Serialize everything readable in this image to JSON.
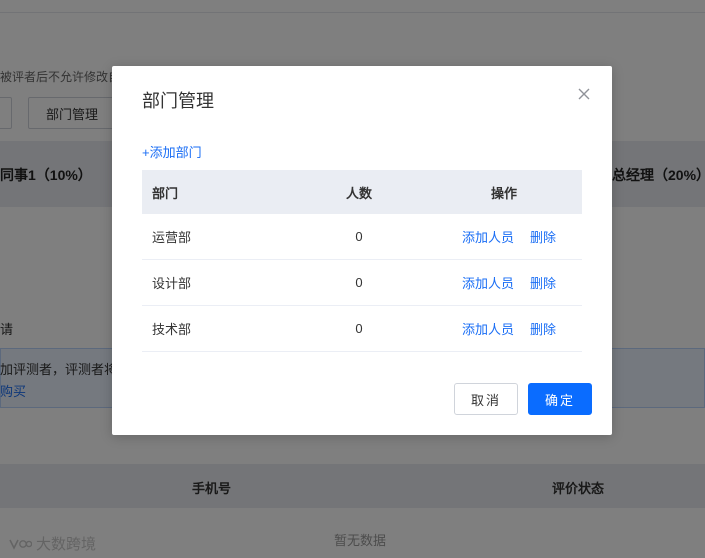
{
  "background": {
    "note": "被评者后不允许修改自",
    "btn_left": "",
    "btn_dept": "部门管理",
    "band_left": "同事1（10%）",
    "band_right": "总经理（20%）",
    "invite": "请",
    "info_line1": "加评测者，评测者将",
    "info_line2": "购买",
    "table_col_phone": "手机号",
    "table_col_status": "评价状态",
    "empty_text": "暂无数据",
    "watermark": "大数跨境"
  },
  "dialog": {
    "title": "部门管理",
    "add_department": "+添加部门",
    "columns": [
      "部门",
      "人数",
      "操作"
    ],
    "rows": [
      {
        "name": "运营部",
        "count": "0",
        "add_action": "添加人员",
        "delete_action": "删除"
      },
      {
        "name": "设计部",
        "count": "0",
        "add_action": "添加人员",
        "delete_action": "删除"
      },
      {
        "name": "技术部",
        "count": "0",
        "add_action": "添加人员",
        "delete_action": "删除"
      }
    ],
    "cancel_label": "取消",
    "confirm_label": "确定"
  },
  "colors": {
    "primary": "#0a6cff",
    "link": "#1a6ef5",
    "overlay": "rgba(0,0,0,0.5)"
  },
  "icons": {
    "close": "close-icon"
  }
}
